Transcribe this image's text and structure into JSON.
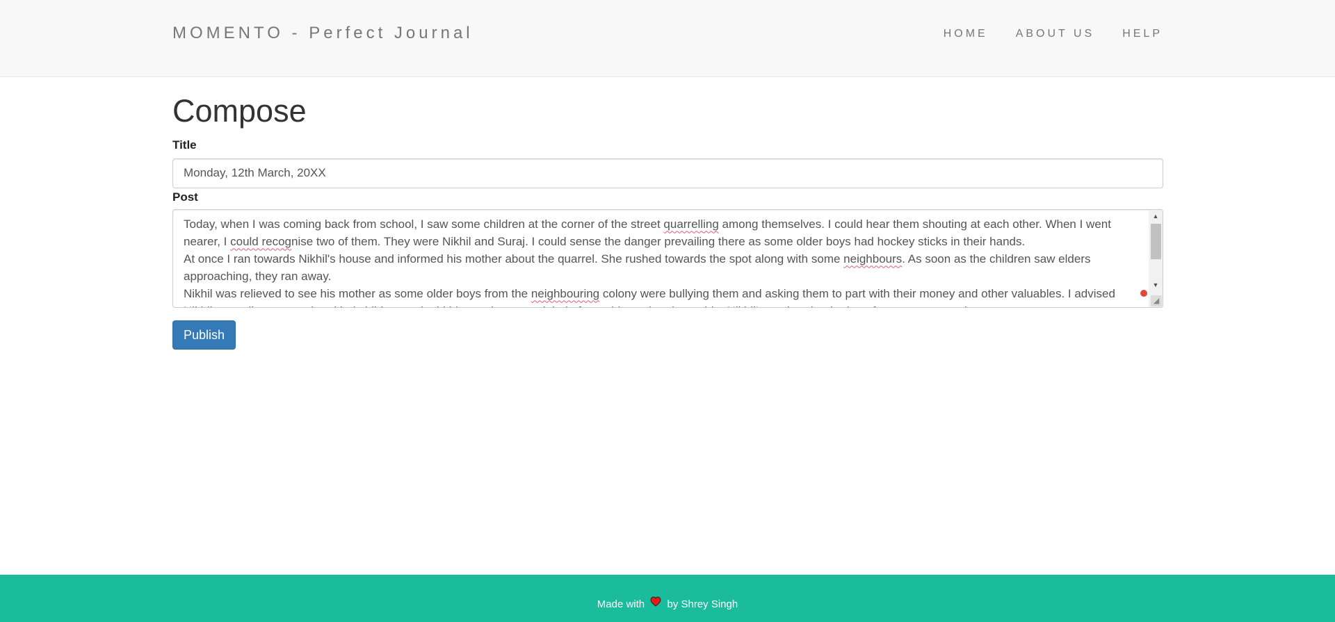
{
  "navbar": {
    "brand": "MOMENTO - Perfect Journal",
    "links": [
      "HOME",
      "ABOUT US",
      "HELP"
    ]
  },
  "compose": {
    "heading": "Compose",
    "title_label": "Title",
    "title_value": "Monday, 12th March, 20XX",
    "post_label": "Post",
    "post_paragraphs": [
      {
        "parts": [
          "Today, when I was coming back from school, I saw some children at the corner of the street ",
          "quarrelling",
          " among themselves. I could hear them shouting at each other. When I went nearer, I ",
          "could recog",
          "nise two of them. They were Nikhil and Suraj. I could sense the danger prevailing there as some older boys had hockey sticks in their hands."
        ]
      },
      {
        "parts": [
          "At once I ran towards Nikhil's house and informed his mother about the quarrel. She rushed towards the spot along with some ",
          "neighbours",
          ". As soon as the children saw elders approaching, they ran away."
        ]
      },
      {
        "parts": [
          "Nikhil was relieved to see his mother as some older boys from the ",
          "neighbouring",
          " colony were bullying them and asking them to part with their money and other valuables. I advised Nikhil not to listen to such unkind children and told him to always seek help from elders when in trouble. Nikhil's mother thanked me for my prompt action."
        ]
      }
    ],
    "publish_label": "Publish"
  },
  "footer": {
    "text_before": "Made with",
    "text_after": "by Shrey Singh",
    "heart_color": "#e41b1b"
  },
  "colors": {
    "navbar_bg": "#f8f8f8",
    "primary": "#337ab7",
    "footer_bg": "#1abc9c"
  }
}
